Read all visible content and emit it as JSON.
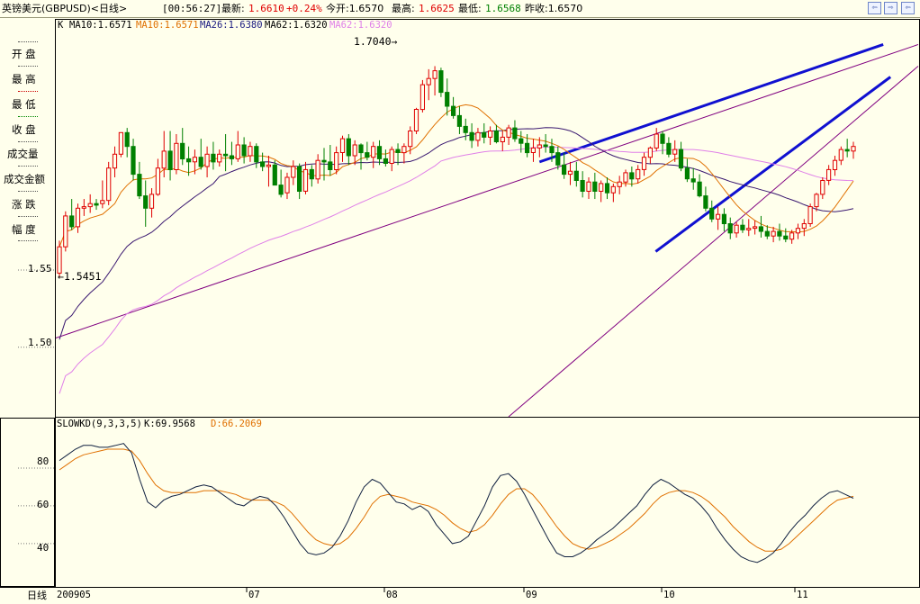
{
  "topbar": {
    "title": "英镑美元(GBPUSD)<日线>",
    "time": "[00:56:27]",
    "latest_label": "最新:",
    "latest_value": "1.6610",
    "change": "+0.24%",
    "open_label": "今开:1.6570",
    "high_label": "最高:",
    "high_value": "1.6625",
    "low_label": "最低:",
    "low_value": "1.6568",
    "prev_close_label": "昨收:1.6570"
  },
  "nav_buttons": [
    "⇦",
    "⇨",
    "⇦"
  ],
  "left_panel": {
    "labels": [
      "开  盘",
      "最  高",
      "最  低",
      "收  盘",
      "成交量",
      "成交金额",
      "涨  跌",
      "幅  度"
    ],
    "placeholder": "------",
    "price_ticks": [
      "1.55",
      "1.50"
    ]
  },
  "ma_legend": {
    "prefix": "K",
    "items": [
      {
        "text": "MA10:1.6571",
        "color": "#000000"
      },
      {
        "text": "MA10:1.6571",
        "color": "#E07000"
      },
      {
        "text": "MA26:1.6380",
        "color": "#1A1A80"
      },
      {
        "text": "MA62:1.6320",
        "color": "#000000"
      },
      {
        "text": "MA62:1.6320",
        "color": "#E080E8"
      }
    ]
  },
  "annotations": {
    "high": "1.7040",
    "low": "1.5451"
  },
  "stoch": {
    "legend_name": "SLOWKD(9,3,3,5)",
    "k_label": "K:69.9568",
    "d_label": "D:66.2069",
    "ticks": [
      "80",
      "60",
      "40"
    ]
  },
  "x_axis": {
    "period_label": "日线",
    "labels": [
      "200905",
      "07",
      "08",
      "09",
      "10",
      "11"
    ]
  },
  "colors": {
    "up": "#E00000",
    "down": "#008000",
    "ma10": "#E07000",
    "ma26": "#3A1870",
    "ma62": "#E080E8",
    "trendline_thin": "#800080",
    "trendline_thick": "#1010D0",
    "k_line": "#102040",
    "d_line": "#E07000"
  },
  "chart_data": [
    {
      "type": "candlestick",
      "title": "英镑美元(GBPUSD)<日线>",
      "ylabel": "",
      "ylim": [
        1.455,
        1.712
      ],
      "x_labels": [
        "200905",
        "07",
        "08",
        "09",
        "10",
        "11"
      ],
      "annotations": {
        "max": 1.704,
        "min": 1.5451
      },
      "candles": [
        [
          1.548,
          1.569,
          1.5451,
          1.565
        ],
        [
          1.565,
          1.588,
          1.562,
          1.585
        ],
        [
          1.585,
          1.596,
          1.576,
          1.578
        ],
        [
          1.578,
          1.593,
          1.574,
          1.59
        ],
        [
          1.59,
          1.596,
          1.585,
          1.591
        ],
        [
          1.591,
          1.599,
          1.587,
          1.593
        ],
        [
          1.593,
          1.596,
          1.589,
          1.592
        ],
        [
          1.593,
          1.608,
          1.59,
          1.595
        ],
        [
          1.595,
          1.62,
          1.592,
          1.616
        ],
        [
          1.616,
          1.63,
          1.61,
          1.625
        ],
        [
          1.625,
          1.638,
          1.623,
          1.639
        ],
        [
          1.639,
          1.642,
          1.623,
          1.63
        ],
        [
          1.63,
          1.635,
          1.608,
          1.612
        ],
        [
          1.612,
          1.62,
          1.596,
          1.598
        ],
        [
          1.598,
          1.608,
          1.578,
          1.59
        ],
        [
          1.59,
          1.603,
          1.584,
          1.599
        ],
        [
          1.599,
          1.622,
          1.598,
          1.616
        ],
        [
          1.616,
          1.64,
          1.61,
          1.627
        ],
        [
          1.627,
          1.64,
          1.608,
          1.615
        ],
        [
          1.615,
          1.638,
          1.612,
          1.632
        ],
        [
          1.632,
          1.642,
          1.618,
          1.622
        ],
        [
          1.622,
          1.63,
          1.611,
          1.62
        ],
        [
          1.62,
          1.628,
          1.612,
          1.623
        ],
        [
          1.623,
          1.635,
          1.615,
          1.617
        ],
        [
          1.617,
          1.63,
          1.61,
          1.625
        ],
        [
          1.625,
          1.633,
          1.615,
          1.62
        ],
        [
          1.62,
          1.628,
          1.617,
          1.625
        ],
        [
          1.625,
          1.638,
          1.614,
          1.624
        ],
        [
          1.624,
          1.633,
          1.618,
          1.622
        ],
        [
          1.622,
          1.64,
          1.62,
          1.631
        ],
        [
          1.631,
          1.636,
          1.619,
          1.624
        ],
        [
          1.624,
          1.633,
          1.62,
          1.63
        ],
        [
          1.63,
          1.632,
          1.616,
          1.62
        ],
        [
          1.62,
          1.626,
          1.614,
          1.617
        ],
        [
          1.617,
          1.624,
          1.604,
          1.618
        ],
        [
          1.618,
          1.621,
          1.607,
          1.605
        ],
        [
          1.605,
          1.615,
          1.597,
          1.599
        ],
        [
          1.6,
          1.613,
          1.596,
          1.61
        ],
        [
          1.61,
          1.621,
          1.605,
          1.617
        ],
        [
          1.617,
          1.619,
          1.596,
          1.601
        ],
        [
          1.601,
          1.62,
          1.599,
          1.615
        ],
        [
          1.615,
          1.618,
          1.604,
          1.609
        ],
        [
          1.609,
          1.625,
          1.606,
          1.621
        ],
        [
          1.621,
          1.629,
          1.608,
          1.62
        ],
        [
          1.62,
          1.631,
          1.611,
          1.615
        ],
        [
          1.615,
          1.63,
          1.612,
          1.626
        ],
        [
          1.626,
          1.637,
          1.62,
          1.635
        ],
        [
          1.635,
          1.638,
          1.618,
          1.624
        ],
        [
          1.624,
          1.634,
          1.618,
          1.631
        ],
        [
          1.631,
          1.632,
          1.615,
          1.626
        ],
        [
          1.626,
          1.633,
          1.621,
          1.623
        ],
        [
          1.623,
          1.633,
          1.616,
          1.63
        ],
        [
          1.63,
          1.634,
          1.618,
          1.622
        ],
        [
          1.622,
          1.628,
          1.617,
          1.619
        ],
        [
          1.619,
          1.63,
          1.614,
          1.628
        ],
        [
          1.628,
          1.632,
          1.618,
          1.626
        ],
        [
          1.626,
          1.632,
          1.619,
          1.63
        ],
        [
          1.63,
          1.643,
          1.625,
          1.64
        ],
        [
          1.64,
          1.655,
          1.638,
          1.654
        ],
        [
          1.654,
          1.673,
          1.652,
          1.67
        ],
        [
          1.67,
          1.68,
          1.66,
          1.674
        ],
        [
          1.674,
          1.682,
          1.663,
          1.679
        ],
        [
          1.679,
          1.681,
          1.662,
          1.665
        ],
        [
          1.665,
          1.674,
          1.65,
          1.656
        ],
        [
          1.656,
          1.662,
          1.648,
          1.65
        ],
        [
          1.65,
          1.656,
          1.638,
          1.643
        ],
        [
          1.643,
          1.648,
          1.634,
          1.639
        ],
        [
          1.639,
          1.645,
          1.629,
          1.634
        ],
        [
          1.634,
          1.642,
          1.63,
          1.639
        ],
        [
          1.639,
          1.645,
          1.632,
          1.636
        ],
        [
          1.636,
          1.643,
          1.631,
          1.64
        ],
        [
          1.64,
          1.644,
          1.632,
          1.633
        ],
        [
          1.633,
          1.64,
          1.627,
          1.636
        ],
        [
          1.636,
          1.644,
          1.631,
          1.642
        ],
        [
          1.642,
          1.647,
          1.633,
          1.635
        ],
        [
          1.635,
          1.64,
          1.626,
          1.632
        ],
        [
          1.632,
          1.638,
          1.623,
          1.626
        ],
        [
          1.626,
          1.635,
          1.62,
          1.629
        ],
        [
          1.629,
          1.636,
          1.623,
          1.631
        ],
        [
          1.631,
          1.638,
          1.626,
          1.63
        ],
        [
          1.63,
          1.635,
          1.62,
          1.626
        ],
        [
          1.626,
          1.63,
          1.615,
          1.618
        ],
        [
          1.618,
          1.626,
          1.609,
          1.612
        ],
        [
          1.612,
          1.62,
          1.605,
          1.614
        ],
        [
          1.614,
          1.62,
          1.604,
          1.608
        ],
        [
          1.608,
          1.614,
          1.597,
          1.601
        ],
        [
          1.601,
          1.61,
          1.596,
          1.607
        ],
        [
          1.607,
          1.613,
          1.596,
          1.601
        ],
        [
          1.601,
          1.608,
          1.594,
          1.606
        ],
        [
          1.606,
          1.61,
          1.596,
          1.6
        ],
        [
          1.6,
          1.606,
          1.594,
          1.604
        ],
        [
          1.604,
          1.611,
          1.599,
          1.607
        ],
        [
          1.607,
          1.615,
          1.604,
          1.613
        ],
        [
          1.613,
          1.617,
          1.604,
          1.609
        ],
        [
          1.609,
          1.618,
          1.606,
          1.615
        ],
        [
          1.615,
          1.626,
          1.611,
          1.623
        ],
        [
          1.623,
          1.63,
          1.619,
          1.629
        ],
        [
          1.629,
          1.642,
          1.627,
          1.638
        ],
        [
          1.638,
          1.64,
          1.625,
          1.632
        ],
        [
          1.632,
          1.636,
          1.623,
          1.625
        ],
        [
          1.625,
          1.634,
          1.62,
          1.628
        ],
        [
          1.628,
          1.633,
          1.614,
          1.616
        ],
        [
          1.616,
          1.622,
          1.607,
          1.609
        ],
        [
          1.609,
          1.616,
          1.602,
          1.607
        ],
        [
          1.607,
          1.612,
          1.597,
          1.598
        ],
        [
          1.598,
          1.604,
          1.588,
          1.59
        ],
        [
          1.59,
          1.595,
          1.581,
          1.583
        ],
        [
          1.583,
          1.591,
          1.576,
          1.586
        ],
        [
          1.586,
          1.59,
          1.575,
          1.58
        ],
        [
          1.58,
          1.584,
          1.57,
          1.574
        ],
        [
          1.574,
          1.581,
          1.571,
          1.579
        ],
        [
          1.579,
          1.583,
          1.574,
          1.576
        ],
        [
          1.576,
          1.583,
          1.572,
          1.577
        ],
        [
          1.577,
          1.582,
          1.573,
          1.578
        ],
        [
          1.578,
          1.585,
          1.571,
          1.575
        ],
        [
          1.575,
          1.579,
          1.57,
          1.572
        ],
        [
          1.572,
          1.578,
          1.568,
          1.575
        ],
        [
          1.575,
          1.58,
          1.569,
          1.572
        ],
        [
          1.572,
          1.577,
          1.568,
          1.57
        ],
        [
          1.57,
          1.576,
          1.567,
          1.574
        ],
        [
          1.574,
          1.58,
          1.57,
          1.577
        ],
        [
          1.577,
          1.583,
          1.572,
          1.58
        ],
        [
          1.58,
          1.593,
          1.578,
          1.591
        ],
        [
          1.591,
          1.6,
          1.588,
          1.599
        ],
        [
          1.599,
          1.61,
          1.596,
          1.608
        ],
        [
          1.608,
          1.618,
          1.605,
          1.615
        ],
        [
          1.615,
          1.624,
          1.611,
          1.621
        ],
        [
          1.621,
          1.63,
          1.618,
          1.628
        ],
        [
          1.628,
          1.635,
          1.623,
          1.627
        ],
        [
          1.627,
          1.633,
          1.622,
          1.63
        ]
      ],
      "series": [
        {
          "name": "MA10"
        },
        {
          "name": "MA26"
        },
        {
          "name": "MA62"
        }
      ]
    },
    {
      "type": "line",
      "title": "SLOWKD(9,3,3,5)",
      "ylim": [
        18,
        100
      ],
      "y_ticks": [
        80,
        60,
        40
      ],
      "series": [
        {
          "name": "K",
          "values": [
            84,
            87,
            90,
            92,
            92,
            91,
            91,
            92,
            93,
            88,
            74,
            62,
            59,
            63,
            65,
            66,
            68,
            70,
            71,
            70,
            67,
            64,
            61,
            60,
            63,
            65,
            64,
            60,
            54,
            47,
            40,
            35,
            34,
            35,
            38,
            44,
            52,
            62,
            70,
            74,
            72,
            67,
            62,
            61,
            58,
            60,
            57,
            50,
            45,
            40,
            41,
            44,
            52,
            60,
            70,
            76,
            77,
            73,
            66,
            58,
            50,
            42,
            35,
            33,
            33,
            35,
            38,
            42,
            45,
            48,
            52,
            56,
            60,
            66,
            71,
            74,
            72,
            69,
            66,
            64,
            60,
            55,
            48,
            42,
            37,
            33,
            31,
            30,
            32,
            35,
            40,
            46,
            51,
            55,
            60,
            64,
            67,
            68,
            66,
            64
          ]
        },
        {
          "name": "D",
          "values": [
            79,
            82,
            85,
            87,
            88,
            89,
            90,
            90,
            90,
            89,
            84,
            77,
            71,
            68,
            67,
            67,
            67,
            67,
            68,
            68,
            68,
            67,
            66,
            64,
            63,
            63,
            63,
            62,
            60,
            56,
            51,
            46,
            42,
            40,
            39,
            40,
            43,
            48,
            54,
            61,
            65,
            66,
            65,
            64,
            62,
            61,
            60,
            58,
            55,
            51,
            48,
            46,
            47,
            50,
            55,
            61,
            66,
            69,
            69,
            66,
            61,
            55,
            49,
            44,
            40,
            38,
            37,
            38,
            40,
            42,
            45,
            48,
            52,
            56,
            61,
            65,
            67,
            68,
            68,
            67,
            65,
            62,
            58,
            54,
            49,
            45,
            41,
            38,
            36,
            36,
            37,
            40,
            44,
            48,
            52,
            56,
            60,
            63,
            64,
            65
          ]
        }
      ]
    }
  ]
}
